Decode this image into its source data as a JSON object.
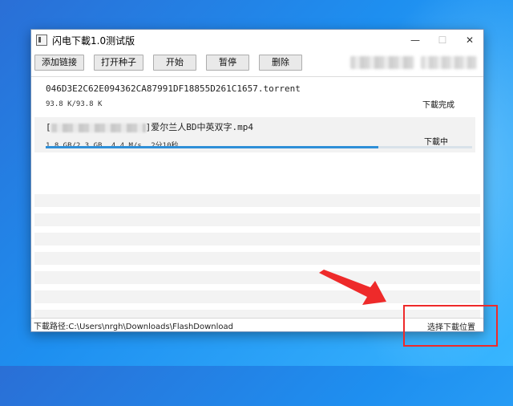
{
  "window": {
    "title": "闪电下載1.0测试版",
    "controls": {
      "minimize": "—",
      "maximize": "☐",
      "close": "✕"
    }
  },
  "toolbar": {
    "add_link": "添加链接",
    "open_seed": "打开种子",
    "start": "开始",
    "pause": "暂停",
    "delete": "删除"
  },
  "downloads": [
    {
      "name": "046D3E2C62E094362CA87991DF18855D261C1657.torrent",
      "size": "93.8 K/93.8 K",
      "status": "下載完成"
    },
    {
      "name_prefix": "[",
      "name_suffix": "]爱尔兰人BD中英双字.mp4",
      "size": "1.8 GB/2.3 GB",
      "speed": "4.4 M/s",
      "eta": "2分10秒",
      "status": "下載中",
      "progress": 0.78
    }
  ],
  "statusbar": {
    "path": "下載路径:C:\\Users\\nrgh\\Downloads\\FlashDownload",
    "choose_location": "选择下載位置"
  },
  "colors": {
    "annotation": "#ee2a2a",
    "progress": "#2f8fd8"
  },
  "icons": [
    "app-icon",
    "minimize-icon",
    "maximize-icon",
    "close-icon",
    "arrow-annotation-icon"
  ]
}
